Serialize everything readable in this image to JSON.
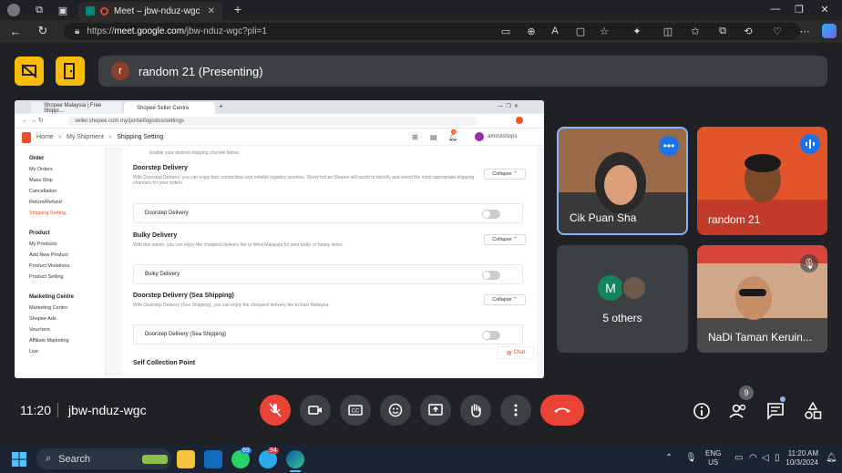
{
  "browser": {
    "tab_title": "Meet – jbw-nduz-wgc",
    "url_host": "meet.google.com",
    "url_path": "/jbw-nduz-wgc?pli=1",
    "url_prefix": "https://"
  },
  "meet": {
    "presenting_label": "random 21 (Presenting)",
    "presenter_initial": "r",
    "time": "11:20",
    "meeting_code": "jbw-nduz-wgc",
    "people_count": "9",
    "participants": [
      {
        "name": "Cik Puan Sha"
      },
      {
        "name": "random 21"
      },
      {
        "name": "5 others",
        "avatar_letter": "M"
      },
      {
        "name": "NaDi Taman Keruin..."
      }
    ]
  },
  "shared_screen": {
    "tabs": [
      "Shopee Malaysia | Free Shippi...",
      "Shopee Seller Centre"
    ],
    "url": "seller.shopee.com.my/portal/logistics/settings",
    "breadcrumb": [
      "Home",
      "My Shipment",
      "Shipping Setting"
    ],
    "account": "amirulshops",
    "notif_count": "73",
    "sidebar": [
      {
        "section": "Order",
        "items": [
          "My Orders",
          "Mass Ship",
          "Cancellation",
          "Return/Refund",
          "Shipping Setting"
        ]
      },
      {
        "section": "Product",
        "items": [
          "My Products",
          "Add New Product",
          "Product Violations",
          "Product Setting"
        ]
      },
      {
        "section": "Marketing Centre",
        "items": [
          "Marketing Centre",
          "Shopee Ads",
          "Vouchers",
          "Affiliate Marketing",
          "Live"
        ]
      }
    ],
    "top_text": "Enable your desired shipping channel below.",
    "sections": [
      {
        "title": "Doorstep Delivery",
        "desc": "With Doorstep Delivery, you can enjoy fast, contactless and reliable logistics services. Worry not as Shopee will assist to identify and select the most appropriate shipping channels for your orders.",
        "option": "Doorstep Delivery",
        "collapse": "Collapse"
      },
      {
        "title": "Bulky Delivery",
        "desc": "With this option, you can enjoy the cheapest delivery fee to West Malaysia for your bulky or heavy items.",
        "option": "Bulky Delivery",
        "collapse": "Collapse"
      },
      {
        "title": "Doorstep Delivery (Sea Shipping)",
        "desc": "With Doorstep Delivery (Sea Shipping), you can enjoy the cheapest delivery fee to East Malaysia.",
        "option": "Doorstep Delivery (Sea Shipping)",
        "collapse": "Collapse"
      },
      {
        "title": "Self Collection Point"
      }
    ],
    "chat_label": "Chat"
  },
  "taskbar": {
    "search_placeholder": "Search",
    "lang": "ENG",
    "region": "US",
    "clock_time": "11:20 AM",
    "clock_date": "10/3/2024",
    "whatsapp_badge": "69",
    "telegram_badge": "94"
  }
}
